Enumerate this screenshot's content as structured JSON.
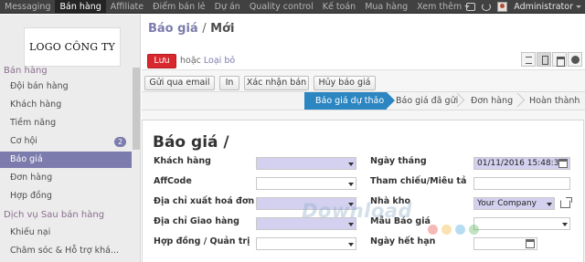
{
  "topbar": {
    "menu": [
      {
        "label": "Messaging",
        "active": false,
        "dropdown": false
      },
      {
        "label": "Bán hàng",
        "active": true,
        "dropdown": false
      },
      {
        "label": "Affiliate",
        "active": false,
        "dropdown": false
      },
      {
        "label": "Điểm bán lẻ",
        "active": false,
        "dropdown": false
      },
      {
        "label": "Dự án",
        "active": false,
        "dropdown": false
      },
      {
        "label": "Quality control",
        "active": false,
        "dropdown": false
      },
      {
        "label": "Kế toán",
        "active": false,
        "dropdown": false
      },
      {
        "label": "Mua hàng",
        "active": false,
        "dropdown": false
      },
      {
        "label": "Xem thêm",
        "active": false,
        "dropdown": true
      }
    ],
    "user_label": "Administrator",
    "icons": [
      "messages-icon",
      "power-icon",
      "avatar"
    ]
  },
  "sidebar": {
    "logo_text": "LOGO CÔNG TY",
    "section_sales": "Bán hàng",
    "items_sales": [
      {
        "label": "Đội bán hàng",
        "active": false,
        "badge": ""
      },
      {
        "label": "Khách hàng",
        "active": false,
        "badge": ""
      },
      {
        "label": "Tiềm năng",
        "active": false,
        "badge": ""
      },
      {
        "label": "Cơ hội",
        "active": false,
        "badge": "2"
      },
      {
        "label": "Báo giá",
        "active": true,
        "badge": ""
      },
      {
        "label": "Đơn hàng",
        "active": false,
        "badge": ""
      },
      {
        "label": "Hợp đồng",
        "active": false,
        "badge": ""
      }
    ],
    "section_service": "Dịch vụ Sau bán hàng",
    "items_service": [
      {
        "label": "Khiếu nại"
      },
      {
        "label": "Chăm sóc & Hỗ trợ khá..."
      }
    ]
  },
  "header": {
    "breadcrumb_parent": "Báo giá",
    "breadcrumb_sep": "/",
    "breadcrumb_current": "Mới",
    "save_label": "Lưu",
    "or_label": "hoặc",
    "discard_label": "Loại bỏ"
  },
  "actions": {
    "buttons": [
      {
        "label": "Gửi qua email"
      },
      {
        "label": "In"
      },
      {
        "label": "Xác nhận bán"
      },
      {
        "label": "Hủy báo giá"
      }
    ]
  },
  "statusbar": {
    "stages": [
      {
        "label": "Báo giá dự thảo",
        "active": true
      },
      {
        "label": "Báo giá đã gửi",
        "active": false
      },
      {
        "label": "Đơn hàng",
        "active": false
      },
      {
        "label": "Hoàn thành",
        "active": false
      }
    ]
  },
  "form": {
    "title": "Báo giá /",
    "left_fields": [
      {
        "label": "Khách hàng",
        "value": "",
        "required": true,
        "dropdown": true
      },
      {
        "label": "AffCode",
        "value": "",
        "required": false,
        "dropdown": true
      },
      {
        "label": "Địa chỉ xuất hoá đơn",
        "value": "",
        "required": true,
        "dropdown": true
      },
      {
        "label": "Địa chỉ Giao hàng",
        "value": "",
        "required": true,
        "dropdown": true
      },
      {
        "label": "Hợp đồng / Quản trị",
        "value": "",
        "required": false,
        "dropdown": true
      }
    ],
    "right_fields": [
      {
        "label": "Ngày tháng",
        "value": "01/11/2016 15:48:38",
        "required": true,
        "kind": "datetime"
      },
      {
        "label": "Tham chiếu/Miêu tả",
        "value": "",
        "required": false,
        "kind": "text"
      },
      {
        "label": "Nhà kho",
        "value": "Your Company",
        "required": true,
        "kind": "select"
      },
      {
        "label": "Mẫu Báo giá",
        "value": "",
        "required": false,
        "kind": "select"
      },
      {
        "label": "Ngày hết hạn",
        "value": "",
        "required": false,
        "kind": "date"
      }
    ]
  },
  "watermark": {
    "text": "Download",
    "dot_colors": [
      "#e1372d",
      "#f2a81d",
      "#2e9bd6",
      "#4caf50"
    ]
  },
  "colors": {
    "navbar": "#414141",
    "accent": "#7c7bad",
    "primary_button": "#d9272e",
    "active_stage": "#2c86c2",
    "required_field": "#d3d1ef"
  }
}
